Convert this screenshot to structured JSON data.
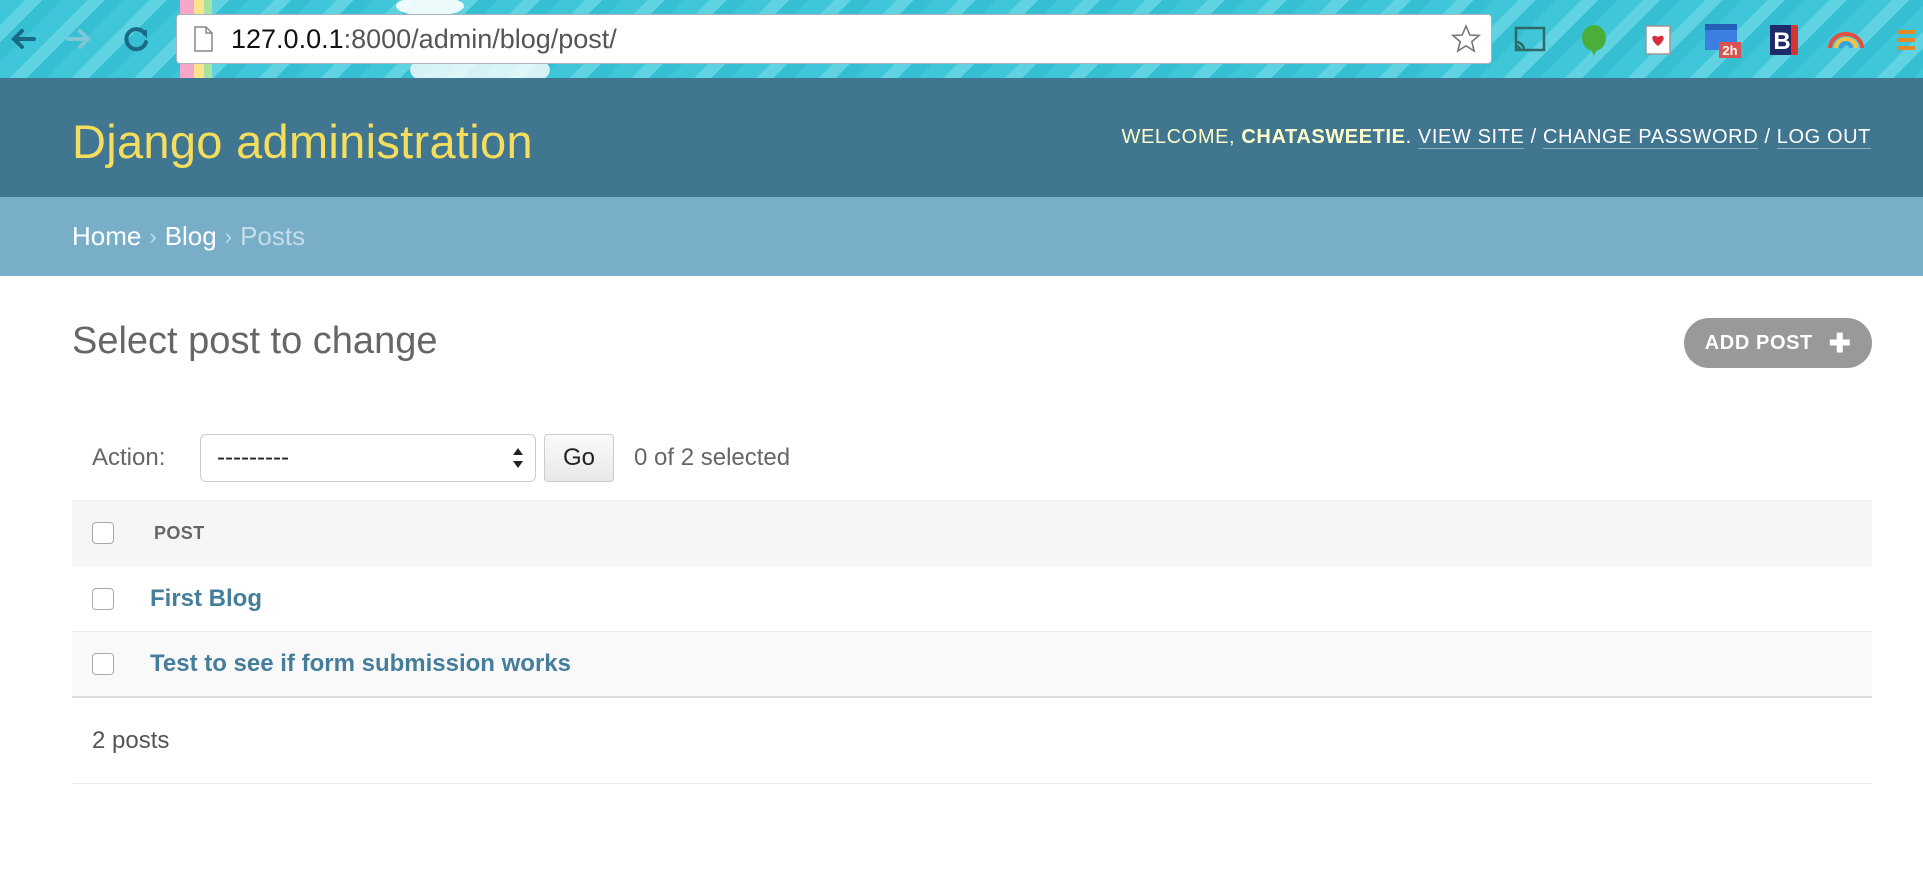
{
  "browser": {
    "url_host": "127.0.0.1",
    "url_rest": ":8000/admin/blog/post/",
    "extensions": [
      {
        "icon": "cast-icon"
      },
      {
        "icon": "evernote-icon"
      },
      {
        "icon": "pocket-icon"
      },
      {
        "icon": "calendar-icon",
        "badge": "2h"
      },
      {
        "icon": "bold-b-icon",
        "label": "B"
      },
      {
        "icon": "rainbow-icon"
      },
      {
        "icon": "menu-icon"
      }
    ]
  },
  "header": {
    "title": "Django administration",
    "welcome": "Welcome,",
    "username": "chatasweetie",
    "view_site": "View site",
    "change_password": "Change password",
    "log_out": "Log out"
  },
  "breadcrumbs": {
    "home": "Home",
    "app": "Blog",
    "current": "Posts",
    "separator": "›"
  },
  "main": {
    "title": "Select post to change",
    "add_button": "Add post",
    "action_label": "Action:",
    "action_value": "---------",
    "go_label": "Go",
    "selected_counter": "0 of 2 selected",
    "column_header": "POST",
    "rows": [
      {
        "title": "First Blog"
      },
      {
        "title": "Test to see if form submission works"
      }
    ],
    "paginator": "2 posts"
  },
  "colors": {
    "header_bg": "#417690",
    "branding": "#f5dd5d",
    "breadcrumb_bg": "#79aec8",
    "link": "#447e9b",
    "add_button_bg": "#999999"
  }
}
